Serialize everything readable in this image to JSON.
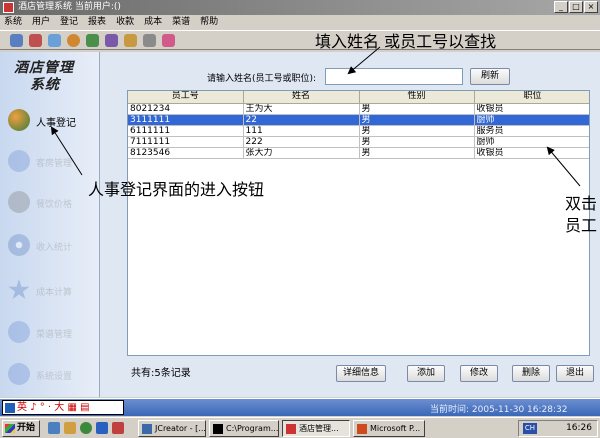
{
  "window": {
    "title": "酒店管理系统 当前用户:()"
  },
  "window_buttons": [
    "_",
    "□",
    "×"
  ],
  "menu": [
    "系统",
    "用户",
    "登记",
    "报表",
    "收款",
    "成本",
    "菜谱",
    "帮助"
  ],
  "toolbar_icons": [
    "tool-1-icon",
    "tool-2-icon",
    "tool-3-icon",
    "tool-4-icon",
    "tool-5-icon",
    "tool-6-icon",
    "tool-7-icon",
    "tool-8-icon",
    "tool-9-icon"
  ],
  "sidebar": {
    "logo_line1": "酒店管理",
    "logo_line2": "系统",
    "items": [
      {
        "label": "人事登记",
        "icon": "people-icon",
        "active": true
      },
      {
        "label": "客房管理",
        "icon": "room-icon"
      },
      {
        "label": "餐饮价格",
        "icon": "dining-icon"
      },
      {
        "label": "收入统计",
        "icon": "disc-icon"
      },
      {
        "label": "成本计算",
        "icon": "star-icon"
      },
      {
        "label": "菜谱管理",
        "icon": "play-icon"
      },
      {
        "label": "系统设置",
        "icon": "info-icon"
      }
    ]
  },
  "search": {
    "label": "请输入姓名(员工号或职位):",
    "value": "",
    "refresh_label": "刷新"
  },
  "table": {
    "columns": [
      "员工号",
      "姓名",
      "性别",
      "职位"
    ],
    "rows": [
      [
        "8021234",
        "王为大",
        "男",
        "收银员"
      ],
      [
        "3111111",
        "22",
        "男",
        "厨师"
      ],
      [
        "6111111",
        "111",
        "男",
        "服务员"
      ],
      [
        "7111111",
        "222",
        "男",
        "厨师"
      ],
      [
        "8123546",
        "张大力",
        "男",
        "收银员"
      ]
    ],
    "selected_row": 1
  },
  "record_count": "共有:5条记录",
  "actions": {
    "details": "详细信息",
    "add": "添加",
    "edit": "修改",
    "delete": "删除",
    "exit": "退出"
  },
  "annotations": {
    "search_hint": "填入姓名 或员工号以查找",
    "entry_hint": "人事登记界面的进入按钮",
    "dblclick_line1": "双击",
    "dblclick_line2": "员工"
  },
  "statusbar": {
    "ime": "英 ♪ ° · 大 ▦ ▤",
    "time": "当前时间: 2005-11-30 16:28:32"
  },
  "taskbar": {
    "start": "开始",
    "tasks": [
      "JCreator - [...",
      "C:\\Program...",
      "酒店管理...",
      "Microsoft P..."
    ],
    "active_task": 2,
    "tray_ime": "CH",
    "clock": "16:26"
  },
  "colors": {
    "selection": "#3168d5",
    "grid_bg": "#ffffff",
    "main_bg": "#dfe7f3",
    "statusbar": "#3a67b8"
  }
}
